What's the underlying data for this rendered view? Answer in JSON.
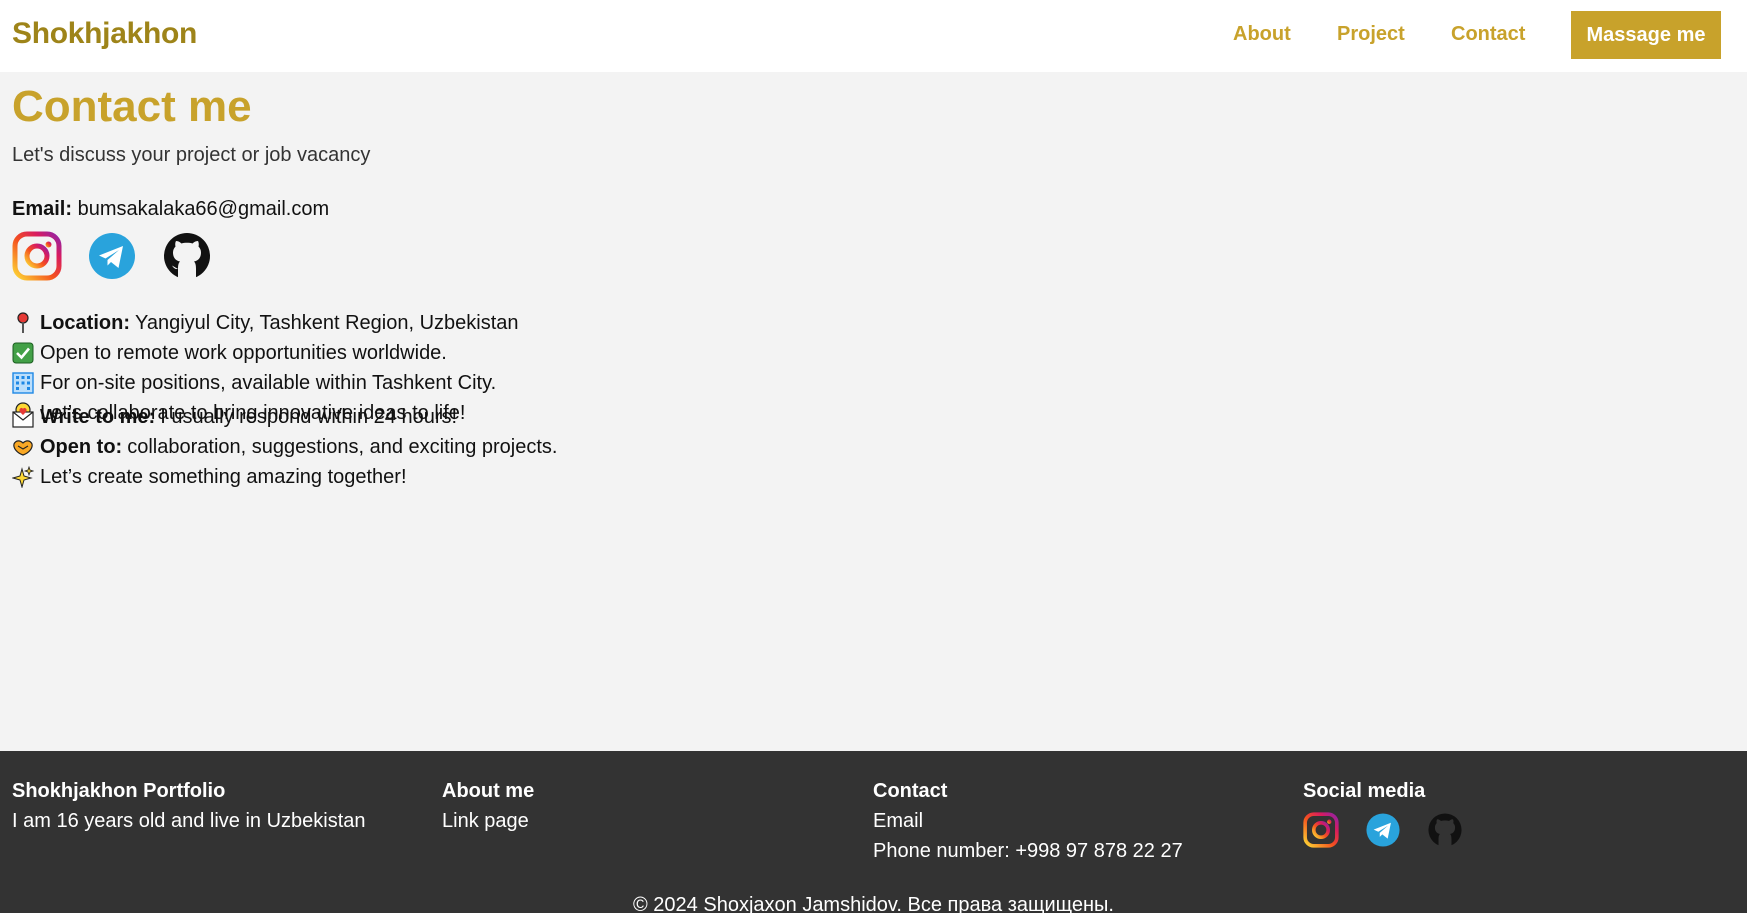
{
  "header": {
    "brand": "Shokhjakhon",
    "nav": [
      "About",
      "Project",
      "Contact"
    ],
    "cta": "Massage me"
  },
  "contact": {
    "title": "Contact me",
    "subtitle": "Let's discuss your project or job vacancy",
    "email_label": "Email:",
    "email_value": "bumsakalaka66@gmail.com",
    "socials": [
      "instagram-icon",
      "telegram-icon",
      "github-icon"
    ],
    "location_label": "Location:",
    "location_value": "Yangiyul City, Tashkent Region, Uzbekistan",
    "remote_text": "Open to remote work opportunities worldwide.",
    "onsite_text": "For on-site positions, available within Tashkent City.",
    "collab_text": "Let’s collaborate to bring innovative ideas to life!",
    "write_label": "Write to me:",
    "write_value": "I usually respond within 24 hours!",
    "open_label": "Open to:",
    "open_value": "collaboration, suggestions, and exciting projects.",
    "create_text": "Let’s create something amazing together!"
  },
  "footer": {
    "portfolio_title": "Shokhjakhon Portfolio",
    "portfolio_text": "I am 16 years old and live in Uzbekistan",
    "about_title": "About me",
    "about_link": "Link page",
    "contact_title": "Contact",
    "contact_email": "Email",
    "contact_phone": "Phone number: +998 97 878 22 27",
    "social_title": "Social media",
    "copyright": "© 2024 Shoxjaxon Jamshidov. Все права защищены."
  },
  "colors": {
    "accent": "#c8a22b",
    "brand": "#9e8419",
    "footer_bg": "#333333",
    "page_bg": "#f3f3f3"
  }
}
